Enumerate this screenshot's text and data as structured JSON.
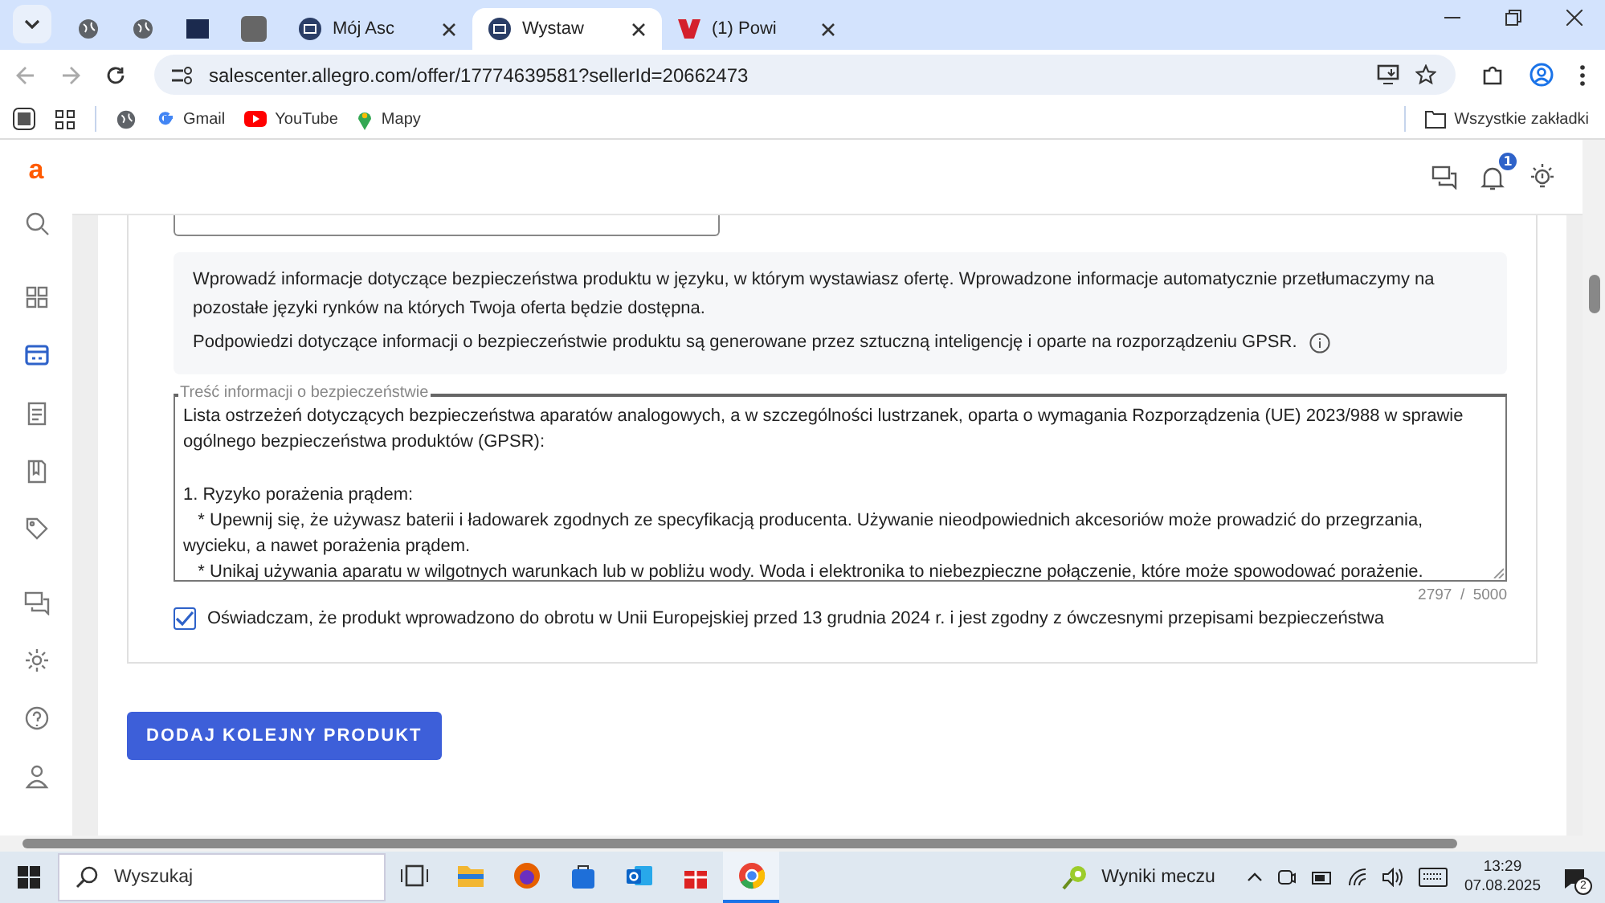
{
  "browser": {
    "tabs": [
      {
        "kind": "favicon",
        "selected": false
      },
      {
        "kind": "favicon",
        "selected": false
      },
      {
        "kind": "favicon",
        "selected": false
      },
      {
        "kind": "favicon",
        "selected": false
      },
      {
        "kind": "titled",
        "title": "Mój Asc",
        "selected": false
      },
      {
        "kind": "titled",
        "title": "Wystaw",
        "selected": true
      },
      {
        "kind": "titled",
        "title": "(1) Powi",
        "selected": false
      }
    ],
    "url": "salescenter.allegro.com/offer/17774639581?sellerId=20662473",
    "bookmarks": [
      {
        "label": "Gmail"
      },
      {
        "label": "YouTube"
      },
      {
        "label": "Mapy"
      }
    ],
    "all_bookmarks": "Wszystkie zakładki"
  },
  "app": {
    "logo": "a",
    "sidebar": [
      {
        "selected": false
      },
      {
        "selected": false
      },
      {
        "selected": true
      },
      {
        "selected": false
      },
      {
        "selected": false
      },
      {
        "selected": false
      },
      {
        "selected": false
      },
      {
        "selected": false
      },
      {
        "selected": false
      },
      {
        "selected": false
      }
    ],
    "notifications_badge": "1"
  },
  "form": {
    "info": [
      "Wprowadź informacje dotyczące bezpieczeństwa produktu w języku, w którym wystawiasz ofertę. Wprowadzone informacje automatycznie przetłumaczymy na pozostałe języki rynków na których Twoja oferta będzie dostępna.",
      "Podpowiedzi dotyczące informacji o bezpieczeństwie produktu są generowane przez sztuczną inteligencję i oparte na rozporządzeniu GPSR."
    ],
    "safety_label": "Treść informacji o bezpieczeństwie",
    "safety_value": "Lista ostrzeżeń dotyczących bezpieczeństwa aparatów analogowych, a w szczególności lustrzanek, oparta o wymagania Rozporządzenia (UE) 2023/988 w sprawie ogólnego bezpieczeństwa produktów (GPSR):\n\n1. Ryzyko porażenia prądem:\n   * Upewnij się, że używasz baterii i ładowarek zgodnych ze specyfikacją producenta. Używanie nieodpowiednich akcesoriów może prowadzić do przegrzania, wycieku, a nawet porażenia prądem.\n   * Unikaj używania aparatu w wilgotnych warunkach lub w pobliżu wody. Woda i elektronika to niebezpieczne połączenie, które może spowodować porażenie.",
    "counter": "2797  /  5000",
    "declaration": {
      "label": "Oświadczam, że produkt wprowadzono do obrotu w Unii Europejskiej przed 13 grudnia 2024 r. i jest zgodny z ówczesnymi przepisami bezpieczeństwa",
      "checked": true
    },
    "add_button": "DODAJ KOLEJNY PRODUKT"
  },
  "taskbar": {
    "search_placeholder": "Wyszukaj",
    "apps": [
      {
        "selected": false
      },
      {
        "selected": false
      },
      {
        "selected": false
      },
      {
        "selected": false
      },
      {
        "selected": false
      },
      {
        "selected": false
      },
      {
        "selected": true
      }
    ],
    "widget": "Wyniki meczu",
    "time": "13:29",
    "date": "07.08.2025",
    "notifications": "2"
  }
}
